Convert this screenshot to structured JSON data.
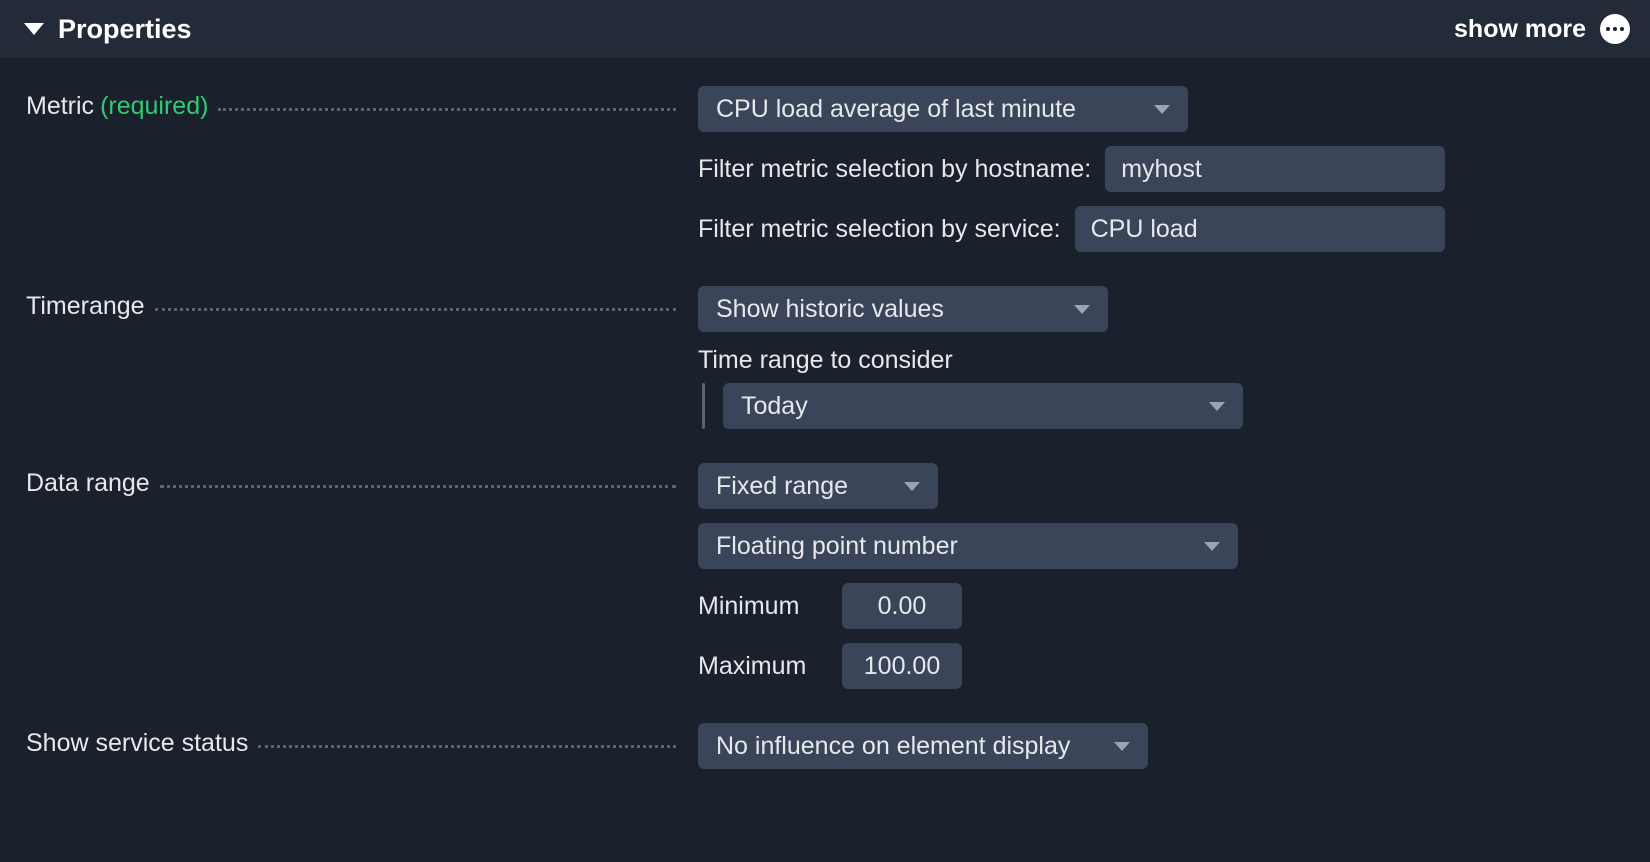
{
  "header": {
    "title": "Properties",
    "show_more": "show more"
  },
  "metric": {
    "label": "Metric",
    "required": "(required)",
    "select": "CPU load average of last minute",
    "filter_host_label": "Filter metric selection by hostname:",
    "filter_host_value": "myhost",
    "filter_service_label": "Filter metric selection by service:",
    "filter_service_value": "CPU load"
  },
  "timerange": {
    "label": "Timerange",
    "select": "Show historic values",
    "sub_label": "Time range to consider",
    "sub_select": "Today"
  },
  "datarange": {
    "label": "Data range",
    "select_mode": "Fixed range",
    "select_type": "Floating point number",
    "min_label": "Minimum",
    "min_value": "0.00",
    "max_label": "Maximum",
    "max_value": "100.00"
  },
  "status": {
    "label": "Show service status",
    "select": "No influence on element display"
  }
}
